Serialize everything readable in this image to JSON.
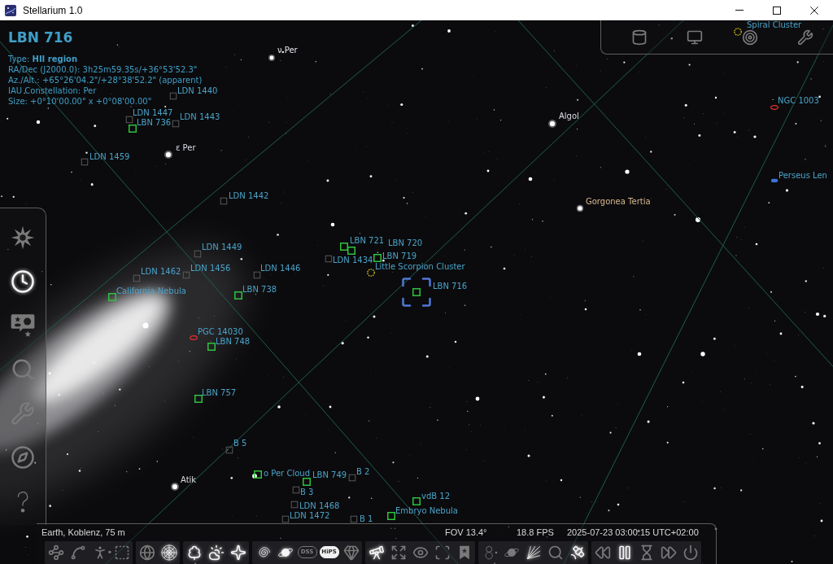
{
  "window": {
    "title": "Stellarium 1.0"
  },
  "info_panel": {
    "title": "LBN 716",
    "lines": [
      "Type: **HII region**",
      "RA/Dec (J2000.0): 3h25m59.35s/+36°53'52.3\"",
      "Az./Alt.: +65°26'04.2\"/+28°38'52.2\" (apparent)",
      "IAU Constellation: Per",
      "Size: +0°10'00.00\" x +0°08'00.00\""
    ]
  },
  "top_panel": {
    "buttons": [
      {
        "kind": "cylinder",
        "on": false
      },
      {
        "kind": "screen",
        "on": false
      },
      {
        "kind": "target",
        "on": false
      },
      {
        "kind": "config",
        "on": false
      }
    ]
  },
  "sky_objects": [
    {
      "text": "Spiral Cluster",
      "kind": "cluster",
      "selected": false
    },
    {
      "text": "ν Per",
      "kind": "star",
      "color": "#e6e6ee",
      "selected": false
    },
    {
      "text": "LDN 1440",
      "kind": "dark",
      "selected": false
    },
    {
      "text": "NGC 1003",
      "kind": "galaxy",
      "selected": false
    },
    {
      "text": "LDN 1447",
      "kind": "dark",
      "selected": false
    },
    {
      "text": "LDN 1443",
      "kind": "dark",
      "selected": false
    },
    {
      "text": "Algol",
      "kind": "star",
      "color": "#dcdce4",
      "selected": false
    },
    {
      "text": "LBN 736",
      "kind": "bright",
      "selected": false
    },
    {
      "text": "ε Per",
      "kind": "star",
      "color": "#d8dce8",
      "selected": false
    },
    {
      "text": "LDN 1459",
      "kind": "dark",
      "selected": false
    },
    {
      "text": "Perseus Len",
      "kind": "lenticular",
      "selected": false
    },
    {
      "text": "LDN 1442",
      "kind": "dark",
      "selected": false
    },
    {
      "text": "Gorgonea Tertia",
      "kind": "star",
      "color": "#d8b88e",
      "selected": false
    },
    {
      "text": "LDN 1449",
      "kind": "dark",
      "selected": false
    },
    {
      "text": "LBN 721",
      "kind": "bright",
      "selected": false
    },
    {
      "text": "LBN 720",
      "kind": "bright",
      "selected": false
    },
    {
      "text": "LDN 1434",
      "kind": "dark",
      "selected": false
    },
    {
      "text": "LBN 719",
      "kind": "bright",
      "selected": false
    },
    {
      "text": "LDN 1462",
      "kind": "dark",
      "selected": false
    },
    {
      "text": "LDN 1456",
      "kind": "dark",
      "selected": false
    },
    {
      "text": "LDN 1446",
      "kind": "dark",
      "selected": false
    },
    {
      "text": "Little Scorpion Cluster",
      "kind": "cluster",
      "selected": false
    },
    {
      "text": "California Nebula",
      "kind": "bright",
      "selected": false
    },
    {
      "text": "LBN 738",
      "kind": "bright",
      "selected": false
    },
    {
      "text": "LBN 716",
      "kind": "bright",
      "selected": true
    },
    {
      "text": "PGC 14030",
      "kind": "galaxy",
      "selected": false
    },
    {
      "text": "LBN 748",
      "kind": "bright",
      "selected": false
    },
    {
      "text": "LBN 757",
      "kind": "bright",
      "selected": false
    },
    {
      "text": "B 5",
      "kind": "dark",
      "selected": false
    },
    {
      "text": "Atik",
      "kind": "star",
      "color": "#dcdce4",
      "selected": false
    },
    {
      "text": "ο Per Cloud",
      "kind": "bright",
      "selected": false
    },
    {
      "text": "LBN 749",
      "kind": "bright",
      "selected": false
    },
    {
      "text": "B 2",
      "kind": "dark",
      "selected": false
    },
    {
      "text": "B 3",
      "kind": "dark",
      "selected": false
    },
    {
      "text": "vdB 12",
      "kind": "bright",
      "selected": false
    },
    {
      "text": "LDN 1468",
      "kind": "dark",
      "selected": false
    },
    {
      "text": "Embryo Nebula",
      "kind": "bright",
      "selected": false
    },
    {
      "text": "LDN 1472",
      "kind": "dark",
      "selected": false
    },
    {
      "text": "B 1",
      "kind": "dark",
      "selected": false
    }
  ],
  "sidebar": {
    "buttons": [
      {
        "kind": "location",
        "on": false
      },
      {
        "kind": "clock",
        "on": true
      },
      {
        "kind": "skyobjects",
        "on": false
      },
      {
        "kind": "search",
        "on": false
      },
      {
        "kind": "config",
        "on": false
      },
      {
        "kind": "compass",
        "on": false
      },
      {
        "kind": "help",
        "on": false
      }
    ]
  },
  "status_bar": {
    "location": "Earth, Koblenz, 75 m",
    "fov": "FOV 13.4°",
    "fps": "18.8 FPS",
    "datetime": "2025-07-23 03:00:15 UTC+02:00"
  },
  "toolbar": {
    "groups": [
      {
        "buttons": [
          {
            "kind": "lines",
            "on": false
          },
          {
            "kind": "labels",
            "on": false
          },
          {
            "kind": "art",
            "on": false
          },
          {
            "kind": "boundaries",
            "on": false
          }
        ]
      },
      {
        "buttons": [
          {
            "kind": "equatorial",
            "on": false
          },
          {
            "kind": "azimuthal",
            "on": true
          }
        ]
      },
      {
        "buttons": [
          {
            "kind": "ground",
            "on": true
          },
          {
            "kind": "atmosphere",
            "on": true
          },
          {
            "kind": "cardinal",
            "on": true
          }
        ]
      },
      {
        "buttons": [
          {
            "kind": "nebulae",
            "on": true
          },
          {
            "kind": "planets",
            "on": true
          },
          {
            "kind": "text",
            "label": "DSS",
            "on": false
          },
          {
            "kind": "text",
            "label": "HiPS",
            "on": true
          },
          {
            "kind": "gem",
            "on": false
          }
        ]
      },
      {
        "buttons": [
          {
            "kind": "telescope",
            "on": true
          },
          {
            "kind": "expand",
            "on": false
          },
          {
            "kind": "eye",
            "on": false
          },
          {
            "kind": "fullscreen",
            "on": false
          },
          {
            "kind": "bookmark",
            "on": false
          }
        ]
      },
      {
        "buttons": [
          {
            "kind": "orbits",
            "on": false
          },
          {
            "kind": "planets",
            "on": false
          },
          {
            "kind": "meteors",
            "on": true
          },
          {
            "kind": "search",
            "on": false
          },
          {
            "kind": "satellite",
            "on": true
          }
        ]
      },
      {
        "buttons": [
          {
            "kind": "rewind",
            "on": false
          },
          {
            "kind": "pause",
            "on": true
          },
          {
            "kind": "realtime",
            "on": false
          },
          {
            "kind": "forward",
            "on": false
          },
          {
            "kind": "quit",
            "on": false
          }
        ]
      }
    ]
  }
}
